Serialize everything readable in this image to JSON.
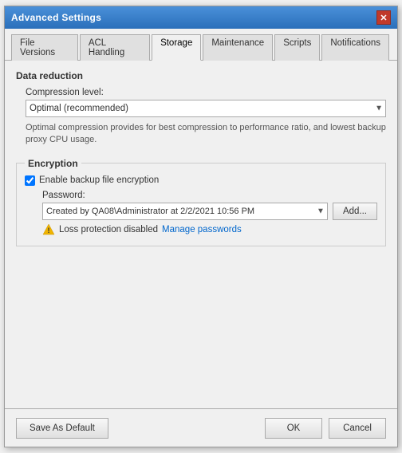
{
  "window": {
    "title": "Advanced Settings",
    "close_button": "✕"
  },
  "tabs": [
    {
      "id": "file-versions",
      "label": "File Versions",
      "active": false
    },
    {
      "id": "acl-handling",
      "label": "ACL Handling",
      "active": false
    },
    {
      "id": "storage",
      "label": "Storage",
      "active": true
    },
    {
      "id": "maintenance",
      "label": "Maintenance",
      "active": false
    },
    {
      "id": "scripts",
      "label": "Scripts",
      "active": false
    },
    {
      "id": "notifications",
      "label": "Notifications",
      "active": false
    }
  ],
  "storage": {
    "data_reduction": {
      "section_title": "Data reduction",
      "compression_label": "Compression level:",
      "compression_value": "Optimal (recommended)",
      "compression_description": "Optimal compression provides for best compression to performance ratio, and lowest backup proxy CPU usage."
    },
    "encryption": {
      "section_title": "Encryption",
      "enable_label": "Enable backup file encryption",
      "password_label": "Password:",
      "password_value": "Created by QA08\\Administrator at 2/2/2021 10:56 PM",
      "add_button": "Add...",
      "warning_text": "Loss protection disabled",
      "manage_passwords_link": "Manage passwords"
    }
  },
  "bottom": {
    "save_default": "Save As Default",
    "ok": "OK",
    "cancel": "Cancel"
  },
  "icons": {
    "warning": "⚠",
    "dropdown_arrow": "▼"
  }
}
